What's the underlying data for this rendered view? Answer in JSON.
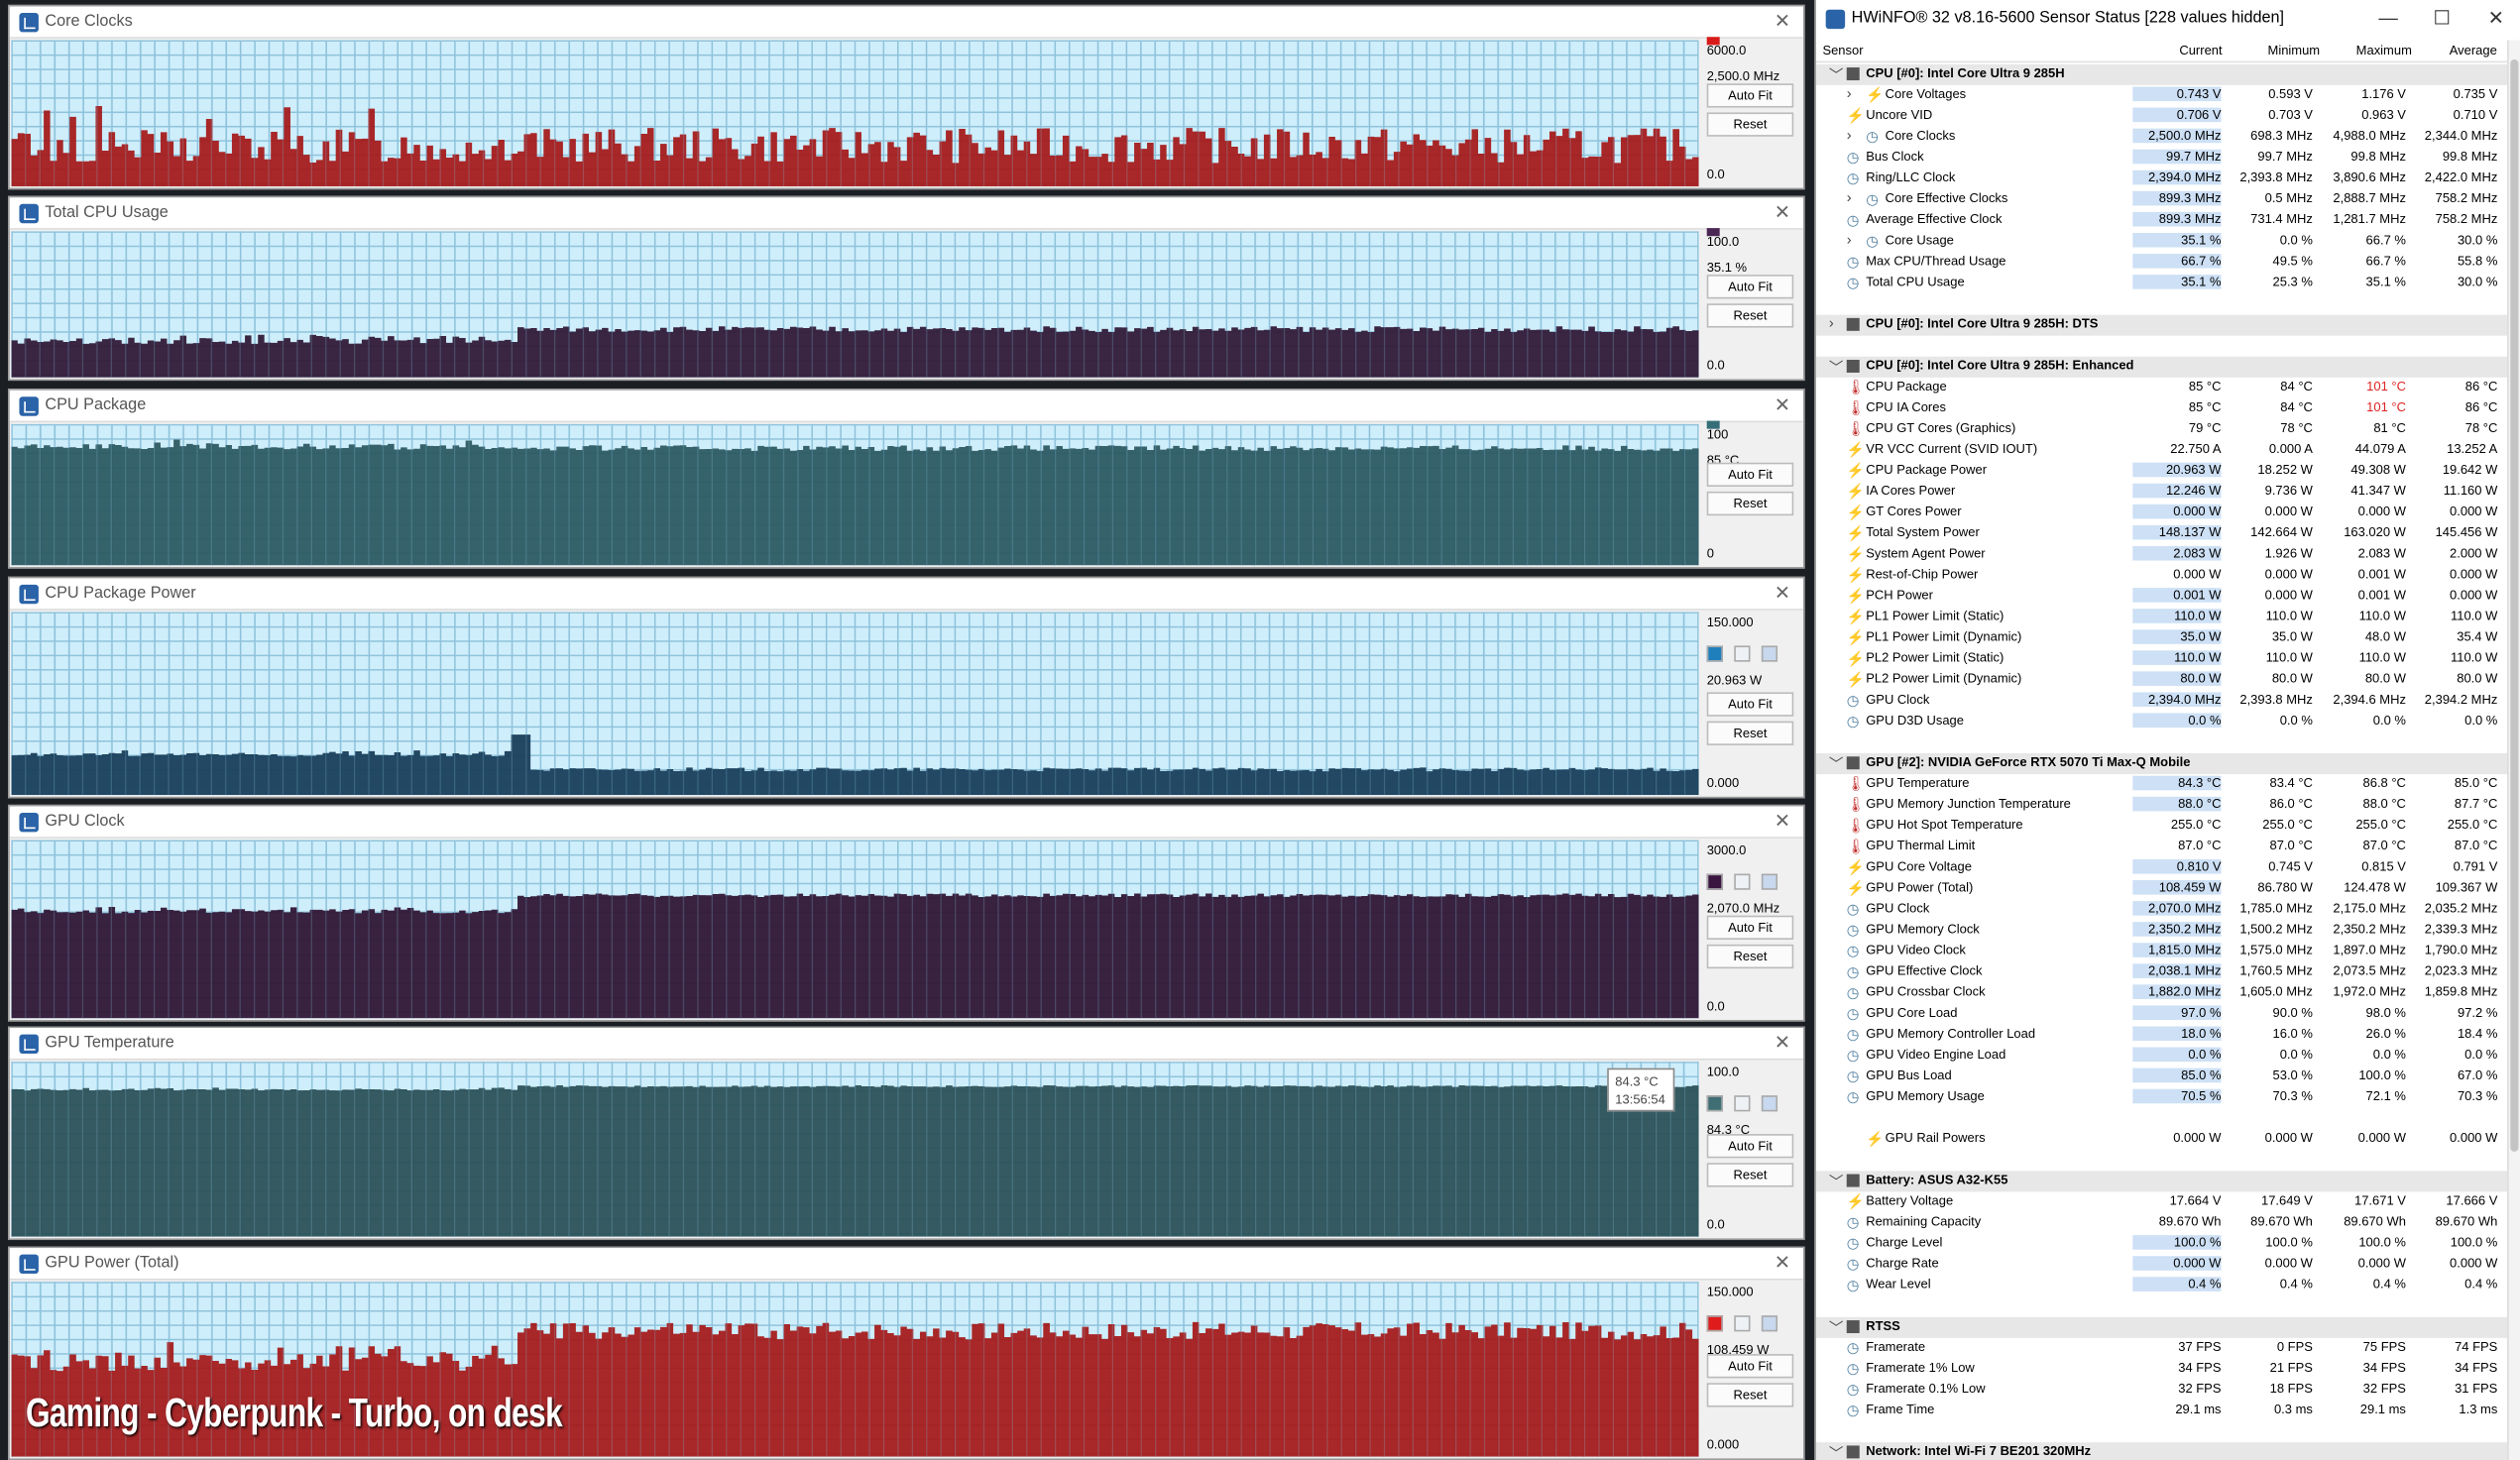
{
  "graphs": [
    {
      "title": "Core Clocks",
      "max": "6000.0",
      "current": "2,500.0 MHz",
      "min": "0.0",
      "color": "#a51818",
      "level_before": 0.27,
      "level_after": 0.28,
      "noise": 0.12,
      "switch": 0.3,
      "swatch": "#d91a1a",
      "show_swatches": false
    },
    {
      "title": "Total CPU Usage",
      "max": "100.0",
      "current": "35.1 %",
      "min": "0.0",
      "color": "#2e1735",
      "level_before": 0.25,
      "level_after": 0.33,
      "noise": 0.02,
      "switch": 0.3,
      "swatch": "#4b2755",
      "show_swatches": false
    },
    {
      "title": "CPU Package",
      "max": "100",
      "current": "85 °C",
      "min": "0",
      "color": "#2a5760",
      "level_before": 0.84,
      "level_after": 0.83,
      "noise": 0.02,
      "switch": 0.3,
      "swatch": "#356e77",
      "show_swatches": false
    },
    {
      "title": "CPU Package Power",
      "max": "150.000",
      "current": "20.963 W",
      "min": "0.000",
      "color": "#163b57",
      "level_before": 0.22,
      "level_after": 0.14,
      "noise": 0.01,
      "switch": 0.3,
      "swatch": "#1f7fbd",
      "show_swatches": true
    },
    {
      "title": "GPU Clock",
      "max": "3000.0",
      "current": "2,070.0 MHz",
      "min": "0.0",
      "color": "#2d1232",
      "level_before": 0.6,
      "level_after": 0.69,
      "noise": 0.01,
      "switch": 0.3,
      "swatch": "#3a1540",
      "show_swatches": true
    },
    {
      "title": "GPU Temperature",
      "max": "100.0",
      "current": "84.3 °C",
      "min": "0.0",
      "color": "#294f55",
      "level_before": 0.84,
      "level_after": 0.86,
      "noise": 0.005,
      "switch": 0.3,
      "swatch": "#3f6f74",
      "show_swatches": true
    },
    {
      "title": "GPU Power (Total)",
      "max": "150.000",
      "current": "108.459 W",
      "min": "0.000",
      "color": "#a51818",
      "level_before": 0.54,
      "level_after": 0.72,
      "noise": 0.05,
      "switch": 0.3,
      "swatch": "#e01b1b",
      "show_swatches": true
    }
  ],
  "buttons": {
    "autofit": "Auto Fit",
    "reset": "Reset"
  },
  "tooltip": {
    "value": "84.3 °C",
    "time": "13:56:54"
  },
  "overlay_caption": "Gaming - Cyberpunk - Turbo, on desk",
  "hwinfo": {
    "title": "HWiNFO® 32 v8.16-5600 Sensor Status [228 values hidden]",
    "columns": [
      "Sensor",
      "Current",
      "Minimum",
      "Maximum",
      "Average"
    ],
    "rows": [
      {
        "t": "group",
        "name": "CPU [#0]: Intel Core Ultra 9 285H",
        "open": true
      },
      {
        "t": "child",
        "icon": "bolt",
        "name": "Core Voltages",
        "vals": [
          "0.743 V",
          "0.593 V",
          "1.176 V",
          "0.735 V"
        ],
        "exp": true
      },
      {
        "t": "item",
        "icon": "bolt",
        "name": "Uncore VID",
        "vals": [
          "0.706 V",
          "0.703 V",
          "0.963 V",
          "0.710 V"
        ]
      },
      {
        "t": "child",
        "icon": "clock",
        "name": "Core Clocks",
        "vals": [
          "2,500.0 MHz",
          "698.3 MHz",
          "4,988.0 MHz",
          "2,344.0 MHz"
        ],
        "exp": true
      },
      {
        "t": "item",
        "icon": "clock",
        "name": "Bus Clock",
        "vals": [
          "99.7 MHz",
          "99.7 MHz",
          "99.8 MHz",
          "99.8 MHz"
        ]
      },
      {
        "t": "item",
        "icon": "clock",
        "name": "Ring/LLC Clock",
        "vals": [
          "2,394.0 MHz",
          "2,393.8 MHz",
          "3,890.6 MHz",
          "2,422.0 MHz"
        ]
      },
      {
        "t": "child",
        "icon": "clock",
        "name": "Core Effective Clocks",
        "vals": [
          "899.3 MHz",
          "0.5 MHz",
          "2,888.7 MHz",
          "758.2 MHz"
        ],
        "exp": true
      },
      {
        "t": "item",
        "icon": "clock",
        "name": "Average Effective Clock",
        "vals": [
          "899.3 MHz",
          "731.4 MHz",
          "1,281.7 MHz",
          "758.2 MHz"
        ]
      },
      {
        "t": "child",
        "icon": "clock",
        "name": "Core Usage",
        "vals": [
          "35.1 %",
          "0.0 %",
          "66.7 %",
          "30.0 %"
        ],
        "exp": true
      },
      {
        "t": "item",
        "icon": "clock",
        "name": "Max CPU/Thread Usage",
        "vals": [
          "66.7 %",
          "49.5 %",
          "66.7 %",
          "55.8 %"
        ]
      },
      {
        "t": "item",
        "icon": "clock",
        "name": "Total CPU Usage",
        "vals": [
          "35.1 %",
          "25.3 %",
          "35.1 %",
          "30.0 %"
        ]
      },
      {
        "t": "blank"
      },
      {
        "t": "group",
        "name": "CPU [#0]: Intel Core Ultra 9 285H: DTS",
        "open": false
      },
      {
        "t": "blank"
      },
      {
        "t": "group",
        "name": "CPU [#0]: Intel Core Ultra 9 285H: Enhanced",
        "open": true
      },
      {
        "t": "item",
        "icon": "therm",
        "name": "CPU Package",
        "vals": [
          "85 °C",
          "84 °C",
          "101 °C",
          "86 °C"
        ],
        "red": 2
      },
      {
        "t": "item",
        "icon": "therm",
        "name": "CPU IA Cores",
        "vals": [
          "85 °C",
          "84 °C",
          "101 °C",
          "86 °C"
        ],
        "red": 2
      },
      {
        "t": "item",
        "icon": "therm",
        "name": "CPU GT Cores (Graphics)",
        "vals": [
          "79 °C",
          "78 °C",
          "81 °C",
          "78 °C"
        ]
      },
      {
        "t": "item",
        "icon": "bolt",
        "name": "VR VCC Current (SVID IOUT)",
        "vals": [
          "22.750 A",
          "0.000 A",
          "44.079 A",
          "13.252 A"
        ]
      },
      {
        "t": "item",
        "icon": "bolt",
        "name": "CPU Package Power",
        "vals": [
          "20.963 W",
          "18.252 W",
          "49.308 W",
          "19.642 W"
        ]
      },
      {
        "t": "item",
        "icon": "bolt",
        "name": "IA Cores Power",
        "vals": [
          "12.246 W",
          "9.736 W",
          "41.347 W",
          "11.160 W"
        ]
      },
      {
        "t": "item",
        "icon": "bolt",
        "name": "GT Cores Power",
        "vals": [
          "0.000 W",
          "0.000 W",
          "0.000 W",
          "0.000 W"
        ]
      },
      {
        "t": "item",
        "icon": "bolt",
        "name": "Total System Power",
        "vals": [
          "148.137 W",
          "142.664 W",
          "163.020 W",
          "145.456 W"
        ]
      },
      {
        "t": "item",
        "icon": "bolt",
        "name": "System Agent Power",
        "vals": [
          "2.083 W",
          "1.926 W",
          "2.083 W",
          "2.000 W"
        ]
      },
      {
        "t": "item",
        "icon": "bolt",
        "name": "Rest-of-Chip Power",
        "vals": [
          "0.000 W",
          "0.000 W",
          "0.001 W",
          "0.000 W"
        ]
      },
      {
        "t": "item",
        "icon": "bolt",
        "name": "PCH Power",
        "vals": [
          "0.001 W",
          "0.000 W",
          "0.001 W",
          "0.000 W"
        ]
      },
      {
        "t": "item",
        "icon": "bolt",
        "name": "PL1 Power Limit (Static)",
        "vals": [
          "110.0 W",
          "110.0 W",
          "110.0 W",
          "110.0 W"
        ]
      },
      {
        "t": "item",
        "icon": "bolt",
        "name": "PL1 Power Limit (Dynamic)",
        "vals": [
          "35.0 W",
          "35.0 W",
          "48.0 W",
          "35.4 W"
        ]
      },
      {
        "t": "item",
        "icon": "bolt",
        "name": "PL2 Power Limit (Static)",
        "vals": [
          "110.0 W",
          "110.0 W",
          "110.0 W",
          "110.0 W"
        ]
      },
      {
        "t": "item",
        "icon": "bolt",
        "name": "PL2 Power Limit (Dynamic)",
        "vals": [
          "80.0 W",
          "80.0 W",
          "80.0 W",
          "80.0 W"
        ]
      },
      {
        "t": "item",
        "icon": "clock",
        "name": "GPU Clock",
        "vals": [
          "2,394.0 MHz",
          "2,393.8 MHz",
          "2,394.6 MHz",
          "2,394.2 MHz"
        ]
      },
      {
        "t": "item",
        "icon": "clock",
        "name": "GPU D3D Usage",
        "vals": [
          "0.0 %",
          "0.0 %",
          "0.0 %",
          "0.0 %"
        ]
      },
      {
        "t": "blank"
      },
      {
        "t": "group",
        "name": "GPU [#2]: NVIDIA  GeForce RTX 5070 Ti Max-Q Mobile",
        "open": true
      },
      {
        "t": "item",
        "icon": "therm",
        "name": "GPU Temperature",
        "vals": [
          "84.3 °C",
          "83.4 °C",
          "86.8 °C",
          "85.0 °C"
        ]
      },
      {
        "t": "item",
        "icon": "therm",
        "name": "GPU Memory Junction Temperature",
        "vals": [
          "88.0 °C",
          "86.0 °C",
          "88.0 °C",
          "87.7 °C"
        ]
      },
      {
        "t": "item",
        "icon": "therm",
        "name": "GPU Hot Spot Temperature",
        "vals": [
          "255.0 °C",
          "255.0 °C",
          "255.0 °C",
          "255.0 °C"
        ]
      },
      {
        "t": "item",
        "icon": "therm",
        "name": "GPU Thermal Limit",
        "vals": [
          "87.0 °C",
          "87.0 °C",
          "87.0 °C",
          "87.0 °C"
        ]
      },
      {
        "t": "item",
        "icon": "bolt",
        "name": "GPU Core Voltage",
        "vals": [
          "0.810 V",
          "0.745 V",
          "0.815 V",
          "0.791 V"
        ]
      },
      {
        "t": "item",
        "icon": "bolt",
        "name": "GPU Power (Total)",
        "vals": [
          "108.459 W",
          "86.780 W",
          "124.478 W",
          "109.367 W"
        ]
      },
      {
        "t": "item",
        "icon": "clock",
        "name": "GPU Clock",
        "vals": [
          "2,070.0 MHz",
          "1,785.0 MHz",
          "2,175.0 MHz",
          "2,035.2 MHz"
        ]
      },
      {
        "t": "item",
        "icon": "clock",
        "name": "GPU Memory Clock",
        "vals": [
          "2,350.2 MHz",
          "1,500.2 MHz",
          "2,350.2 MHz",
          "2,339.3 MHz"
        ]
      },
      {
        "t": "item",
        "icon": "clock",
        "name": "GPU Video Clock",
        "vals": [
          "1,815.0 MHz",
          "1,575.0 MHz",
          "1,897.0 MHz",
          "1,790.0 MHz"
        ]
      },
      {
        "t": "item",
        "icon": "clock",
        "name": "GPU Effective Clock",
        "vals": [
          "2,038.1 MHz",
          "1,760.5 MHz",
          "2,073.5 MHz",
          "2,023.3 MHz"
        ]
      },
      {
        "t": "item",
        "icon": "clock",
        "name": "GPU Crossbar Clock",
        "vals": [
          "1,882.0 MHz",
          "1,605.0 MHz",
          "1,972.0 MHz",
          "1,859.8 MHz"
        ]
      },
      {
        "t": "item",
        "icon": "clock",
        "name": "GPU Core Load",
        "vals": [
          "97.0 %",
          "90.0 %",
          "98.0 %",
          "97.2 %"
        ]
      },
      {
        "t": "item",
        "icon": "clock",
        "name": "GPU Memory Controller Load",
        "vals": [
          "18.0 %",
          "16.0 %",
          "26.0 %",
          "18.4 %"
        ]
      },
      {
        "t": "item",
        "icon": "clock",
        "name": "GPU Video Engine Load",
        "vals": [
          "0.0 %",
          "0.0 %",
          "0.0 %",
          "0.0 %"
        ]
      },
      {
        "t": "item",
        "icon": "clock",
        "name": "GPU Bus Load",
        "vals": [
          "85.0 %",
          "53.0 %",
          "100.0 %",
          "67.0 %"
        ]
      },
      {
        "t": "item",
        "icon": "clock",
        "name": "GPU Memory Usage",
        "vals": [
          "70.5 %",
          "70.3 %",
          "72.1 %",
          "70.3 %"
        ]
      },
      {
        "t": "blank"
      },
      {
        "t": "child",
        "icon": "bolt",
        "name": "GPU Rail Powers",
        "vals": [
          "0.000 W",
          "0.000 W",
          "0.000 W",
          "0.000 W"
        ],
        "exp": false
      },
      {
        "t": "blank"
      },
      {
        "t": "group",
        "name": "Battery: ASUS  A32-K55",
        "open": true
      },
      {
        "t": "item",
        "icon": "bolt",
        "name": "Battery Voltage",
        "vals": [
          "17.664 V",
          "17.649 V",
          "17.671 V",
          "17.666 V"
        ]
      },
      {
        "t": "item",
        "icon": "clock",
        "name": "Remaining Capacity",
        "vals": [
          "89.670 Wh",
          "89.670 Wh",
          "89.670 Wh",
          "89.670 Wh"
        ]
      },
      {
        "t": "item",
        "icon": "clock",
        "name": "Charge Level",
        "vals": [
          "100.0 %",
          "100.0 %",
          "100.0 %",
          "100.0 %"
        ]
      },
      {
        "t": "item",
        "icon": "clock",
        "name": "Charge Rate",
        "vals": [
          "0.000 W",
          "0.000 W",
          "0.000 W",
          "0.000 W"
        ]
      },
      {
        "t": "item",
        "icon": "clock",
        "name": "Wear Level",
        "vals": [
          "0.4 %",
          "0.4 %",
          "0.4 %",
          "0.4 %"
        ]
      },
      {
        "t": "blank"
      },
      {
        "t": "group",
        "name": "RTSS",
        "open": true
      },
      {
        "t": "item",
        "icon": "clock",
        "name": "Framerate",
        "vals": [
          "37 FPS",
          "0 FPS",
          "75 FPS",
          "74 FPS"
        ]
      },
      {
        "t": "item",
        "icon": "clock",
        "name": "Framerate 1% Low",
        "vals": [
          "34 FPS",
          "21 FPS",
          "34 FPS",
          "34 FPS"
        ]
      },
      {
        "t": "item",
        "icon": "clock",
        "name": "Framerate 0.1% Low",
        "vals": [
          "32 FPS",
          "18 FPS",
          "32 FPS",
          "31 FPS"
        ]
      },
      {
        "t": "item",
        "icon": "clock",
        "name": "Frame Time",
        "vals": [
          "29.1 ms",
          "0.3 ms",
          "29.1 ms",
          "1.3 ms"
        ]
      },
      {
        "t": "blank"
      },
      {
        "t": "group",
        "name": "Network: Intel Wi-Fi 7 BE201 320MHz",
        "open": true
      }
    ],
    "highlight_current": [
      1,
      2,
      3,
      4,
      5,
      6,
      7,
      8,
      9,
      10,
      19,
      20,
      21,
      22,
      23,
      25,
      26,
      27,
      28,
      29,
      30,
      31,
      34,
      35,
      38,
      39,
      40,
      41,
      42,
      43,
      44,
      45,
      46,
      47,
      48,
      49,
      50,
      56,
      57,
      58,
      59,
      60
    ]
  }
}
